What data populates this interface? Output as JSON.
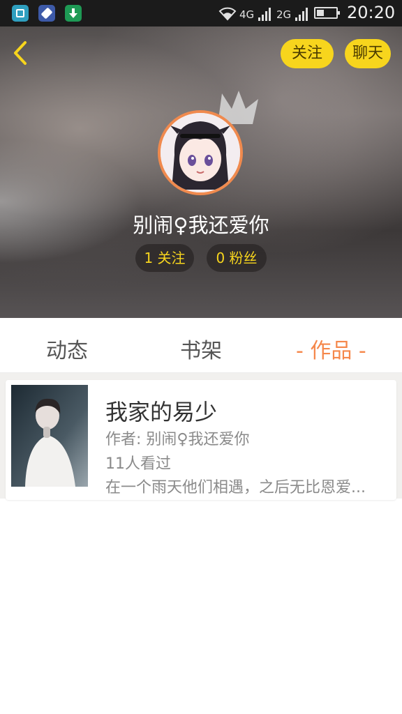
{
  "status_bar": {
    "network_1": "4G",
    "network_2": "2G",
    "time": "20:20",
    "icons": [
      "gallery-icon",
      "shuttle-icon",
      "download-icon",
      "wifi-icon",
      "signal-icon",
      "battery-icon"
    ]
  },
  "header": {
    "follow_label": "关注",
    "chat_label": "聊天",
    "username": "别闹♀我还爱你",
    "following": "1 关注",
    "fans": "0 粉丝",
    "accent": "#f7d51d"
  },
  "tabs": [
    {
      "label": "动态"
    },
    {
      "label": "书架"
    },
    {
      "label": "- 作品 -",
      "active": true
    }
  ],
  "tab_active_color": "#f5874a",
  "works": [
    {
      "title": "我家的易少",
      "author": "作者: 别闹♀我还爱你",
      "views": "11人看过",
      "description": "在一个雨天他们相遇，之后无比恩爱..."
    }
  ]
}
